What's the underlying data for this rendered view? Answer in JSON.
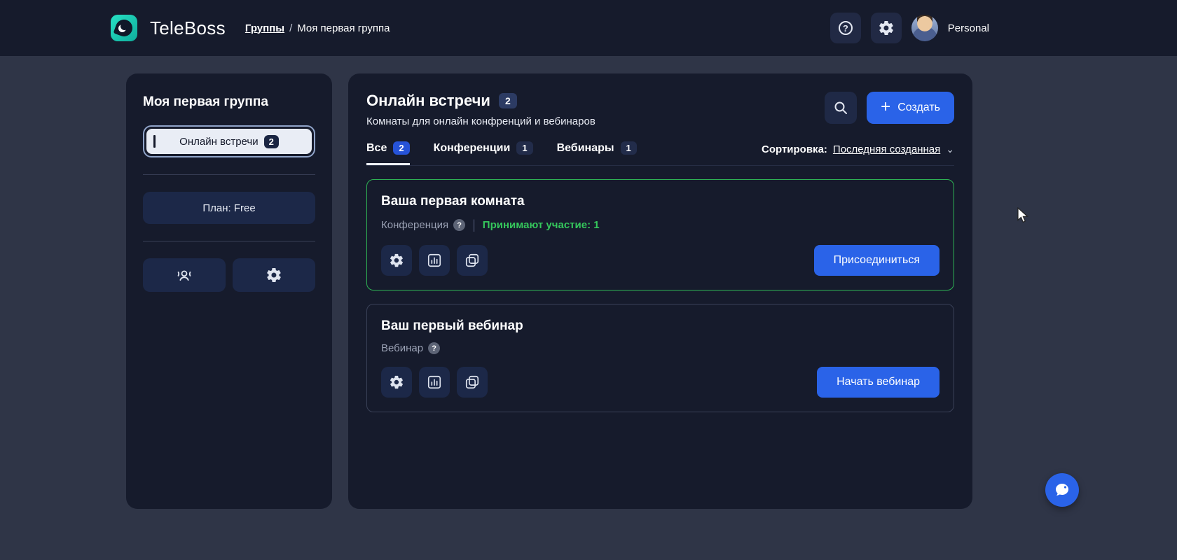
{
  "colors": {
    "accent_blue": "#2a63e8",
    "success_green": "#35c75c",
    "page_background": "#2f3547",
    "panel_background": "#161b2c",
    "brand_teal": "#1ccab2"
  },
  "icons": {
    "plus": "+",
    "question_mark": "?",
    "chevron_down": "⌄",
    "breadcrumb_separator": "/"
  },
  "header": {
    "brand": "TeleBoss",
    "breadcrumb_link": "Группы",
    "breadcrumb_current": "Моя первая группа",
    "profile_label": "Personal"
  },
  "sidebar": {
    "group_title": "Моя первая группа",
    "nav_item": {
      "label": "Онлайн встречи",
      "badge": "2"
    },
    "plan_button": "План: Free"
  },
  "main": {
    "title": "Онлайн встречи",
    "title_badge": "2",
    "subtitle": "Комнаты для онлайн конфренций и вебинаров",
    "create_button": "Создать",
    "tabs": [
      {
        "label": "Все",
        "badge": "2"
      },
      {
        "label": "Конференции",
        "badge": "1"
      },
      {
        "label": "Вебинары",
        "badge": "1"
      }
    ],
    "sort_label": "Сортировка:",
    "sort_value": "Последняя созданная",
    "rooms": [
      {
        "title": "Ваша первая комната",
        "type": "Конференция",
        "status": "Принимают участие: 1",
        "action": "Присоединиться"
      },
      {
        "title": "Ваш первый вебинар",
        "type": "Вебинар",
        "action": "Начать вебинар"
      }
    ]
  }
}
